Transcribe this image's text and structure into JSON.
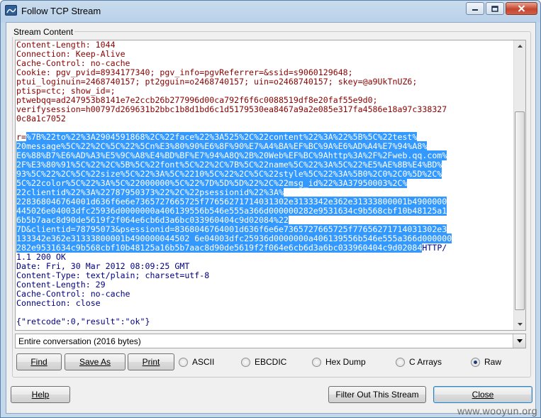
{
  "window": {
    "title": "Follow TCP Stream"
  },
  "group": {
    "label": "Stream Content"
  },
  "stream": {
    "lines": [
      {
        "text": "Content-Length: 1044",
        "kind": "client"
      },
      {
        "text": "Connection: Keep-Alive",
        "kind": "client"
      },
      {
        "text": "Cache-Control: no-cache",
        "kind": "client"
      },
      {
        "text": "Cookie: pgv_pvid=8934177340; pgv_info=pgvReferrer=&ssid=s9060129648;",
        "kind": "client"
      },
      {
        "text": "ptui_loginuin=2468740157; pt2gguin=o2468740157; uin=o2468740157; skey=@a9UkTnUZ6;",
        "kind": "client"
      },
      {
        "text": "ptisp=ctc; show_id=;",
        "kind": "client"
      },
      {
        "text": "ptwebqq=ad247953b8141e7e2ccb26b277996d00ca792f6f6c0088519df8e20faf55e9d0;",
        "kind": "client"
      },
      {
        "text": "verifysession=h00797d269631b2bbc1b8d1bd6c1d5179530ea8467a9a2e085e317fa4586e18a97c338327",
        "kind": "client"
      },
      {
        "text": "0c8a1c7052",
        "kind": "client"
      },
      {
        "text": "",
        "kind": "client"
      },
      {
        "pre": "r=",
        "text": "%7B%22to%22%3A2904591868%2C%22face%22%3A525%2C%22content%22%3A%22%5B%5C%22test%",
        "kind": "client-hl"
      },
      {
        "text": "20message%5C%22%2C%5C%22%5Cn%E3%80%90%E6%8F%90%E7%A4%BA%EF%BC%9A%E6%AD%A4%E7%94%A8%",
        "kind": "hl"
      },
      {
        "text": "E6%88%B7%E6%AD%A3%E5%9C%A8%E4%BD%BF%E7%94%A8Q%2B%20Web%EF%BC%9Ahttp%3A%2F%2Fweb.qq.com%",
        "kind": "hl"
      },
      {
        "text": "2F%E3%80%91%5C%22%2C%5B%5C%22font%5C%22%2C%7B%5C%22name%5C%22%3A%5C%22%E5%AE%8B%E4%BD%",
        "kind": "hl"
      },
      {
        "text": "93%5C%22%2C%5C%22size%5C%22%3A%5C%2210%5C%22%2C%5C%22style%5C%22%3A%5B0%2C0%2C0%5D%2C%",
        "kind": "hl"
      },
      {
        "text": "5C%22color%5C%22%3A%5C%22000000%5C%22%7D%5D%5D%22%2C%22msg_id%22%3A37950003%2C%",
        "kind": "hl"
      },
      {
        "text": "22clientid%22%3A%22787950373%22%2C%22psessionid%22%3A%",
        "kind": "hl"
      },
      {
        "text": "228368046764001d636f6e6e7365727665725f77656271714031302e3133342e362e31333800001b4900000",
        "kind": "hl"
      },
      {
        "text": "445026e04003dfc25936d0000000a406139556b546e555a366d000000282e9531634c9b568cbf10b48125a1",
        "kind": "hl"
      },
      {
        "text": "6b5b7aac8d90de5619f2f064e6cb6d3a6bc033960404c9d02084%22",
        "kind": "hl"
      },
      {
        "text": "7D&clientid=78795073&psessionid=8368046764001d636f6e6e7365727665725f77656271714031302e3",
        "kind": "hl"
      },
      {
        "text": "133342e362e31333800001b490000044502 6e04003dfc25936d0000000a406139556b546e555a366d000000",
        "kind": "hl"
      },
      {
        "text": "282e9531634c9b568cbf10b48125a16b5b7aac8d90de5619f2f064e6cb6d3a6bc033960404c9d02084",
        "post": "HTTP/",
        "kind": "hl-server"
      },
      {
        "text": "1.1 200 OK",
        "kind": "server"
      },
      {
        "text": "Date: Fri, 30 Mar 2012 08:09:25 GMT",
        "kind": "server"
      },
      {
        "text": "Content-Type: text/plain; charset=utf-8",
        "kind": "server"
      },
      {
        "text": "Content-Length: 29",
        "kind": "server"
      },
      {
        "text": "Cache-Control: no-cache",
        "kind": "server"
      },
      {
        "text": "Connection: close",
        "kind": "server"
      },
      {
        "text": "",
        "kind": "server"
      },
      {
        "text": "{\"retcode\":0,\"result\":\"ok\"}",
        "kind": "server"
      }
    ]
  },
  "conversation_select": {
    "value": "Entire conversation (2016 bytes)"
  },
  "buttons": {
    "find": "Find",
    "save_as": "Save As",
    "print": "Print",
    "help": "Help",
    "filter_out": "Filter Out This Stream",
    "close": "Close"
  },
  "format_options": [
    {
      "label": "ASCII",
      "selected": false
    },
    {
      "label": "EBCDIC",
      "selected": false
    },
    {
      "label": "Hex Dump",
      "selected": false
    },
    {
      "label": "C Arrays",
      "selected": false
    },
    {
      "label": "Raw",
      "selected": true
    }
  ],
  "watermark": "www.wooyun.org",
  "colors": {
    "client_text": "#8b0000",
    "server_text": "#000080",
    "selection": "#3399ff"
  }
}
